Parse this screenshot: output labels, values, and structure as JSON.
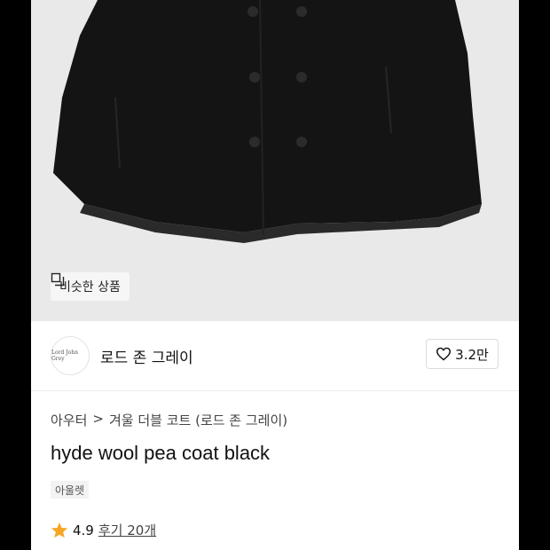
{
  "product_image": {
    "alt": "black double-breasted wool pea coat"
  },
  "similar_button": {
    "label": "비슷한 상품",
    "icon": "stacked-squares-icon"
  },
  "brand": {
    "logo_text": "Lord John Grey",
    "name": "로드 존 그레이"
  },
  "like_button": {
    "count": "3.2만",
    "icon": "heart-icon"
  },
  "breadcrumb": {
    "items": [
      "아우터",
      "겨울 더블 코트 (로드 존 그레이)"
    ],
    "separator": ">"
  },
  "product": {
    "title": "hyde wool pea coat black",
    "tag": "아울렛"
  },
  "rating": {
    "score": "4.9",
    "review_text": "후기 20개",
    "star_color": "#f5a623",
    "icon": "star-icon"
  }
}
